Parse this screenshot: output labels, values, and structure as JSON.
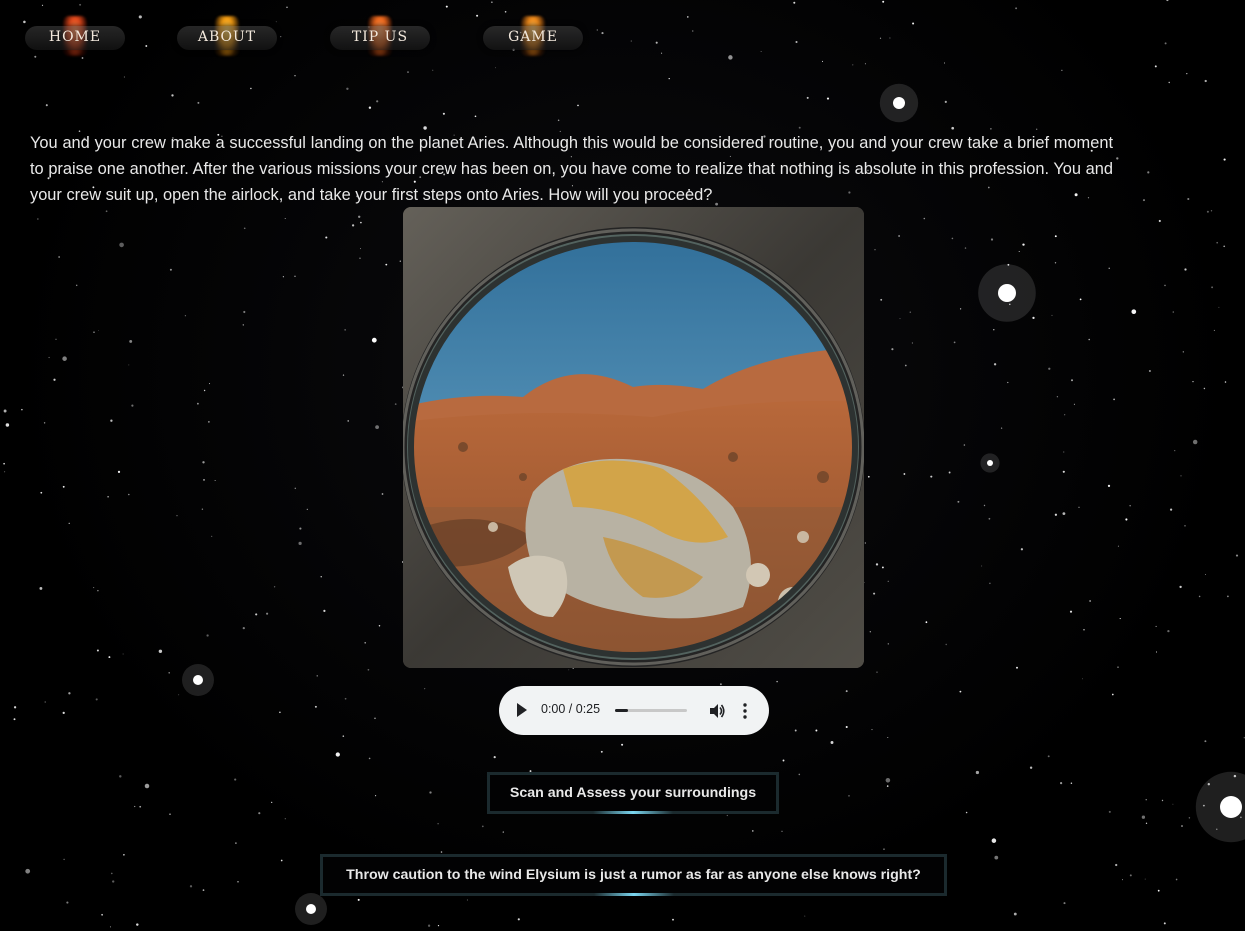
{
  "nav": {
    "items": [
      {
        "label": "HOME",
        "glow": "#e2491c"
      },
      {
        "label": "ABOUT",
        "glow": "#f59d12"
      },
      {
        "label": "TIP US",
        "glow": "#f06a1e"
      },
      {
        "label": "GAME",
        "glow": "#f08a1a"
      }
    ]
  },
  "story": {
    "text": "You and your crew make a successful landing on the planet Aries. Although this would be considered routine, you and your crew take a brief moment to praise one another. After the various missions your crew has been on, you have come to realize that nothing is absolute in this profession. You and your crew suit up, open the airlock, and take your first steps onto Aries. How will you proceed?"
  },
  "scene": {
    "icon": "porthole-landscape-image"
  },
  "audio": {
    "time": "0:00 / 0:25",
    "progress": 0.18
  },
  "choices": [
    {
      "label": "Scan and Assess your surroundings"
    },
    {
      "label": "Throw caution to the wind Elysium is just a rumor as far as anyone else knows right?"
    }
  ],
  "colors": {
    "background": "#000000",
    "text": "#e9e9e9",
    "button_border": "#1b2a2e",
    "button_glow": "#7ad6f0",
    "audio_bg": "#f1f3f4"
  }
}
